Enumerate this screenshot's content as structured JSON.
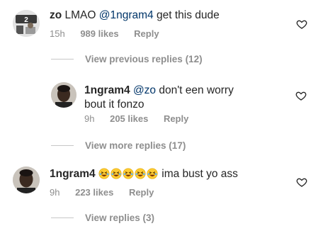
{
  "comments": [
    {
      "username": "zo",
      "text_before": " LMAO ",
      "mention": "@1ngram4",
      "text_after": " get this dude",
      "time": "15h",
      "likes": "989 likes",
      "reply": "Reply"
    },
    {
      "username": "1ngram4",
      "mention": "@zo",
      "line1_after": " don't een worry",
      "line2": "bout it fonzo",
      "time": "9h",
      "likes": "205 likes",
      "reply": "Reply"
    },
    {
      "username": "1ngram4",
      "emoji_count": 5,
      "text_after": " ima bust yo ass",
      "time": "9h",
      "likes": "223 likes",
      "reply": "Reply"
    }
  ],
  "view_previous": "View previous replies (12)",
  "view_more": "View more replies (17)",
  "view_replies": "View replies (3)",
  "icons": {
    "like": "heart-outline-icon",
    "emoji": "grinning-squinting-face-emoji"
  },
  "colors": {
    "mention": "#003569",
    "meta": "#8e8e8e",
    "text": "#262626"
  }
}
